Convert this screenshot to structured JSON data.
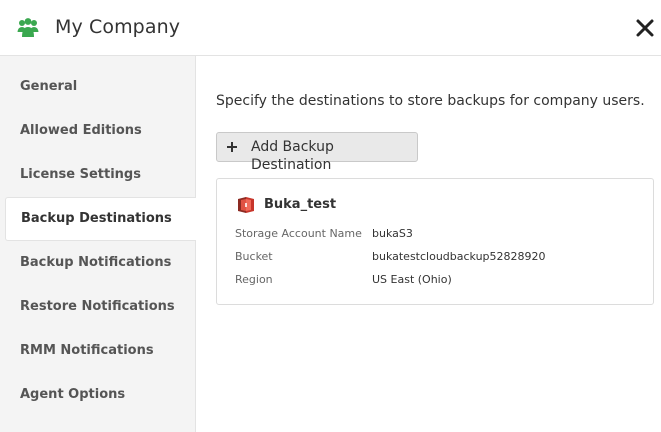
{
  "header": {
    "title": "My Company",
    "icon": "users-group-icon",
    "close_icon": "close-icon",
    "accent_color": "#3aa84f"
  },
  "sidebar": {
    "items": [
      {
        "label": "General",
        "active": false
      },
      {
        "label": "Allowed Editions",
        "active": false
      },
      {
        "label": "License Settings",
        "active": false
      },
      {
        "label": "Backup Destinations",
        "active": true
      },
      {
        "label": "Backup Notifications",
        "active": false
      },
      {
        "label": "Restore Notifications",
        "active": false
      },
      {
        "label": "RMM Notifications",
        "active": false
      },
      {
        "label": "Agent Options",
        "active": false
      }
    ]
  },
  "main": {
    "description": "Specify the destinations to store backups for company users.",
    "add_button": {
      "label": "Add Backup Destination",
      "icon": "plus-icon"
    },
    "destination": {
      "icon": "aws-s3-icon",
      "icon_color": "#c7352b",
      "name": "Buka_test",
      "fields": [
        {
          "label": "Storage Account Name",
          "value": "bukaS3"
        },
        {
          "label": "Bucket",
          "value": "bukatestcloudbackup52828920"
        },
        {
          "label": "Region",
          "value": "US East (Ohio)"
        }
      ]
    }
  }
}
